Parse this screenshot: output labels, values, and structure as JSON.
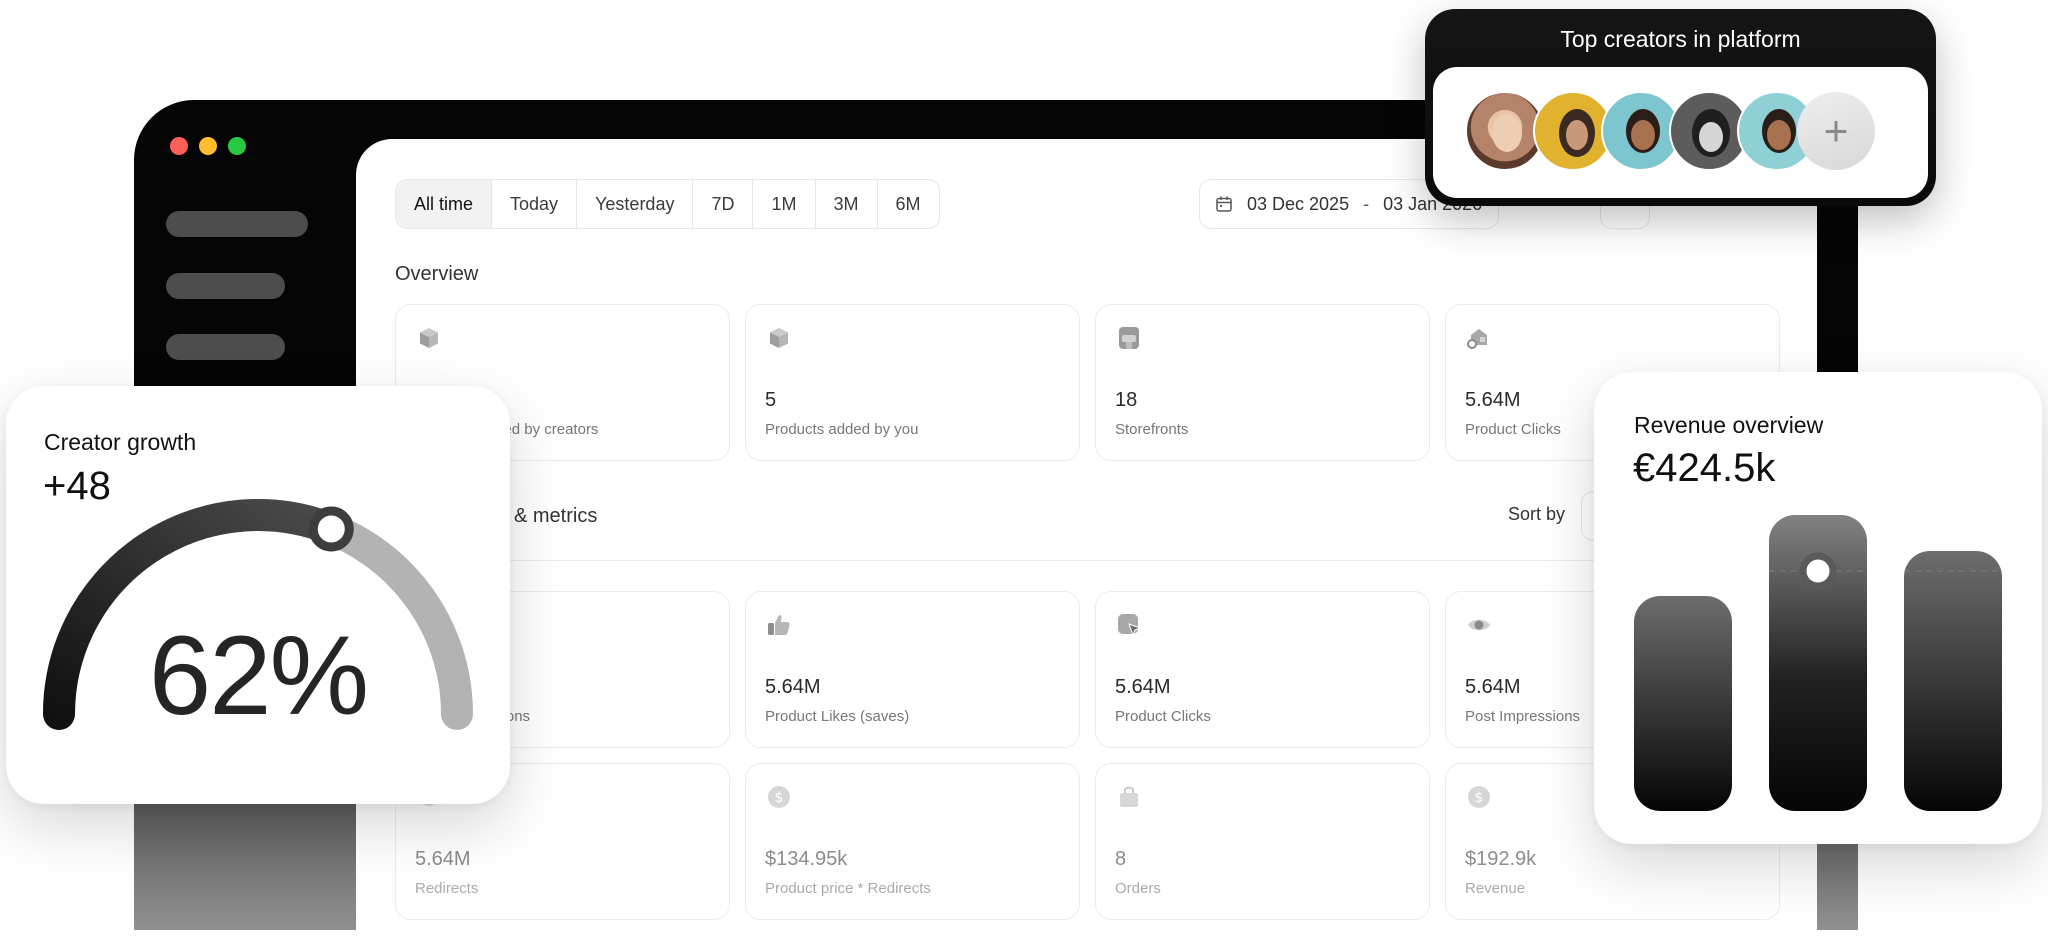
{
  "dashboard": {
    "filters": [
      "All time",
      "Today",
      "Yesterday",
      "7D",
      "1M",
      "3M",
      "6M"
    ],
    "active_filter": "All time",
    "date_range": {
      "start": "03 Dec 2025",
      "separator": "-",
      "end": "03 Jan 2026"
    },
    "overview_title": "Overview",
    "overview_cards": [
      {
        "icon": "box-icon",
        "value": "",
        "label": "Products added by creators"
      },
      {
        "icon": "box-icon",
        "value": "5",
        "label": "Products added by you"
      },
      {
        "icon": "storefront-icon",
        "value": "18",
        "label": "Storefronts"
      },
      {
        "icon": "product-click-icon",
        "value": "5.64M",
        "label": "Product Clicks"
      }
    ],
    "metrics_title": "Engagement & metrics",
    "sort_label": "Sort by",
    "metric_cards_row1": [
      {
        "icon": "impression-icon",
        "value": "",
        "label": "Post Impressions",
        "trend": "%"
      },
      {
        "icon": "thumbs-up-icon",
        "value": "5.64M",
        "label": "Product Likes (saves)"
      },
      {
        "icon": "cursor-click-icon",
        "value": "5.64M",
        "label": "Product Clicks"
      },
      {
        "icon": "eye-icon",
        "value": "5.64M",
        "label": "Post Impressions"
      }
    ],
    "metric_cards_row2": [
      {
        "icon": "redirect-icon",
        "value": "5.64M",
        "label": "Redirects"
      },
      {
        "icon": "dollar-icon",
        "value": "$134.95k",
        "label": "Product price * Redirects"
      },
      {
        "icon": "shopping-bag-icon",
        "value": "8",
        "label": "Orders"
      },
      {
        "icon": "dollar-icon",
        "value": "$192.9k",
        "label": "Revenue"
      }
    ]
  },
  "creator_growth": {
    "title": "Creator growth",
    "value": "+48",
    "percent_label": "62%",
    "progress": 0.62
  },
  "top_creators": {
    "title": "Top creators in platform",
    "add_label": "+"
  },
  "revenue_overview": {
    "title": "Revenue overview",
    "value": "€424.5k"
  },
  "colors": {
    "window": "#050505",
    "sidebar_pill": "#4d4d4d",
    "traffic_red": "#fe5f57",
    "traffic_yellow": "#febc2e",
    "traffic_green": "#28c840",
    "gauge_dark": "#1d1d1d",
    "gauge_light": "#b3b3b3"
  }
}
